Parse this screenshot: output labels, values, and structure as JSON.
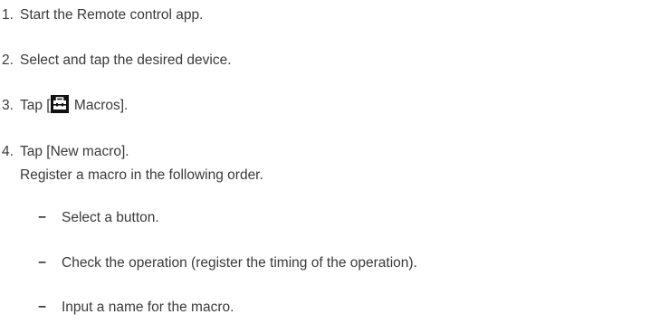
{
  "steps": [
    {
      "num": "1.",
      "text": "Start the Remote control app."
    },
    {
      "num": "2.",
      "text": "Select and tap the desired device."
    },
    {
      "num": "3.",
      "prefix": "Tap [",
      "icon": "toolbox-icon",
      "suffix": " Macros]."
    },
    {
      "num": "4.",
      "text": "Tap [New macro].",
      "subtext": "Register a macro in the following order."
    }
  ],
  "bullets": [
    {
      "mark": "−",
      "text": "Select a button."
    },
    {
      "mark": "−",
      "text": "Check the operation (register the timing of the operation)."
    },
    {
      "mark": "−",
      "text": "Input a name for the macro."
    }
  ],
  "colors": {
    "text": "#3a3a3a",
    "icon_bg": "#111111"
  }
}
